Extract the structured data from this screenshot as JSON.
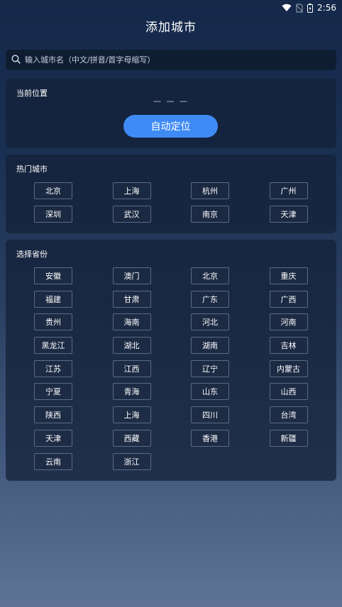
{
  "status_bar": {
    "time": "2:56",
    "icons": [
      "wifi-icon",
      "no-sim-icon",
      "battery-icon"
    ]
  },
  "header": {
    "title": "添加城市"
  },
  "search": {
    "placeholder": "输入城市名（中文/拼音/首字母缩写）",
    "icon": "search-icon"
  },
  "location": {
    "title": "当前位置",
    "value": "— — —",
    "button_label": "自动定位",
    "button_color": "#3f8bf5"
  },
  "hot_cities": {
    "title": "热门城市",
    "items": [
      "北京",
      "上海",
      "杭州",
      "广州",
      "深圳",
      "武汉",
      "南京",
      "天津"
    ]
  },
  "provinces": {
    "title": "选择省份",
    "items": [
      "安徽",
      "澳门",
      "北京",
      "重庆",
      "福建",
      "甘肃",
      "广东",
      "广西",
      "贵州",
      "海南",
      "河北",
      "河南",
      "黑龙江",
      "湖北",
      "湖南",
      "吉林",
      "江苏",
      "江西",
      "辽宁",
      "内蒙古",
      "宁夏",
      "青海",
      "山东",
      "山西",
      "陕西",
      "上海",
      "四川",
      "台湾",
      "天津",
      "西藏",
      "香港",
      "新疆",
      "云南",
      "浙江"
    ]
  }
}
